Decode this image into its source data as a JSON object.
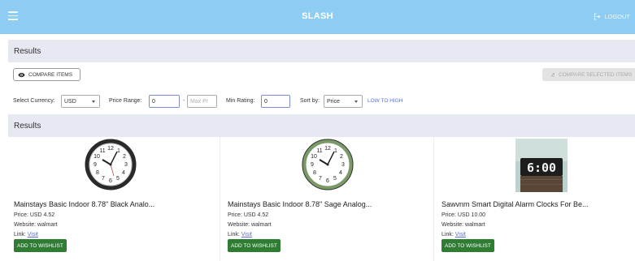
{
  "appbar": {
    "title": "SLASH",
    "logout_label": "LOGOUT"
  },
  "results_header": "Results",
  "toolbar": {
    "compare_items": "COMPARE ITEMS",
    "compare_selected": "COMPARE SELECTED ITEMS"
  },
  "filters": {
    "currency_label": "Select Currency:",
    "currency_value": "USD",
    "price_range_label": "Price Range:",
    "price_min": "0",
    "price_separator": "-",
    "price_max_placeholder": "Max Pr",
    "min_rating_label": "Min Rating:",
    "min_rating_value": "0",
    "sort_label": "Sort by:",
    "sort_value": "Price",
    "sort_direction": "LOW TO HIGH"
  },
  "results_section_title": "Results",
  "products": [
    {
      "name": "Mainstays Basic Indoor 8.78\" Black Analo...",
      "price": "Price: USD 4.52",
      "website": "Website: walmart",
      "link_label": "Link:",
      "link_text": "Visit",
      "wishlist": "ADD TO WISHLIST",
      "image": "black-analog-clock",
      "rim_color": "#2a2a2a"
    },
    {
      "name": "Mainstays Basic Indoor 8.78\" Sage Analog...",
      "price": "Price: USD 4.52",
      "website": "Website: walmart",
      "link_label": "Link:",
      "link_text": "Visit",
      "wishlist": "ADD TO WISHLIST",
      "image": "sage-analog-clock",
      "rim_color": "#7a9a68"
    },
    {
      "name": "Sawvnm Smart Digital Alarm Clocks For Be...",
      "price": "Price: USD 10.00",
      "website": "Website: walmart",
      "link_label": "Link:",
      "link_text": "Visit",
      "wishlist": "ADD TO WISHLIST",
      "image": "digital-alarm-clock",
      "display_time": "6:00"
    }
  ],
  "colors": {
    "appbar": "#8ecdf3",
    "section_bar": "#e6e9f2",
    "wishlist_button": "#2e7d32",
    "link": "#5b6fd0"
  }
}
